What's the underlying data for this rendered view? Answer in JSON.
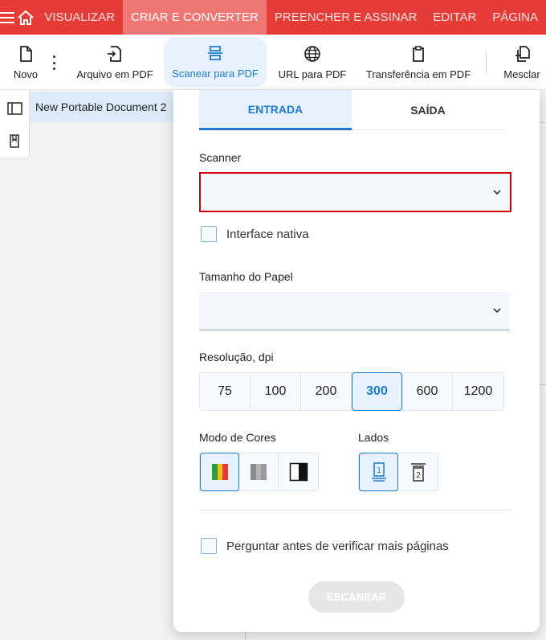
{
  "nav": {
    "tabs": [
      {
        "label": "VISUALIZAR",
        "active": false
      },
      {
        "label": "CRIAR E CONVERTER",
        "active": true
      },
      {
        "label": "PREENCHER E ASSINAR",
        "active": false
      },
      {
        "label": "EDITAR",
        "active": false
      },
      {
        "label": "PÁGINA",
        "active": false
      }
    ]
  },
  "toolbar": {
    "novo": "Novo",
    "arquivo": "Arquivo em PDF",
    "scanear": "Scanear para PDF",
    "url": "URL para PDF",
    "transferencia": "Transferência em PDF",
    "mesclar": "Mesclar"
  },
  "document": {
    "tab_title": "New Portable Document 2"
  },
  "panel": {
    "tabs": {
      "entrada": "ENTRADA",
      "saida": "SAÍDA"
    },
    "scanner_label": "Scanner",
    "scanner_value": "",
    "native_interface_label": "Interface nativa",
    "paper_size_label": "Tamanho do Papel",
    "paper_size_value": "",
    "resolution_label": "Resolução, dpi",
    "resolutions": [
      "75",
      "100",
      "200",
      "300",
      "600",
      "1200"
    ],
    "resolution_selected": "300",
    "color_mode_label": "Modo de Cores",
    "sides_label": "Lados",
    "ask_more_pages_label": "Perguntar antes de verificar mais páginas",
    "scan_button": "ESCANEAR",
    "colors": {
      "accent": "#1e7bd0",
      "error": "#d00000",
      "brand": "#e63c37"
    }
  }
}
